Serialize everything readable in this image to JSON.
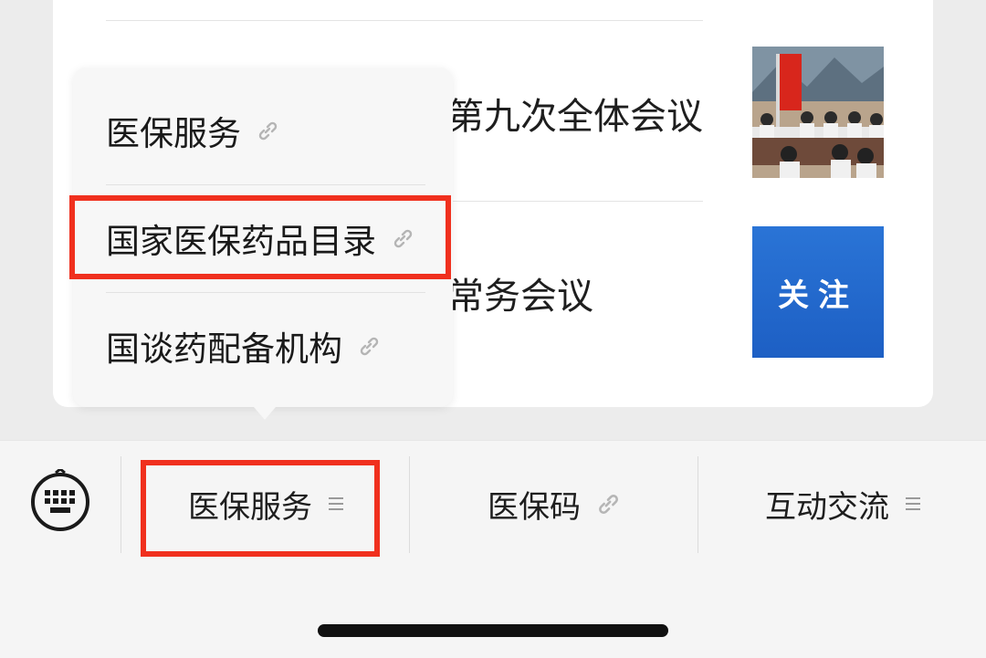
{
  "articles": [
    {
      "title": "第九次全体会议"
    },
    {
      "title": "常务会议",
      "thumb_text": "关注"
    }
  ],
  "popup_menu": {
    "items": [
      {
        "label": "医保服务"
      },
      {
        "label": "国家医保药品目录"
      },
      {
        "label": "国谈药配备机构"
      }
    ]
  },
  "tab_bar": {
    "keyboard_icon": "keyboard-icon",
    "tabs": [
      {
        "label": "医保服务",
        "icon": "menu-icon"
      },
      {
        "label": "医保码",
        "icon": "link-icon"
      },
      {
        "label": "互动交流",
        "icon": "menu-icon"
      }
    ]
  },
  "colors": {
    "highlight": "#f0301e",
    "popup_bg": "#f7f7f7",
    "tabbar_bg": "#f5f5f5",
    "thumb_blue": "#1d5fc4"
  }
}
